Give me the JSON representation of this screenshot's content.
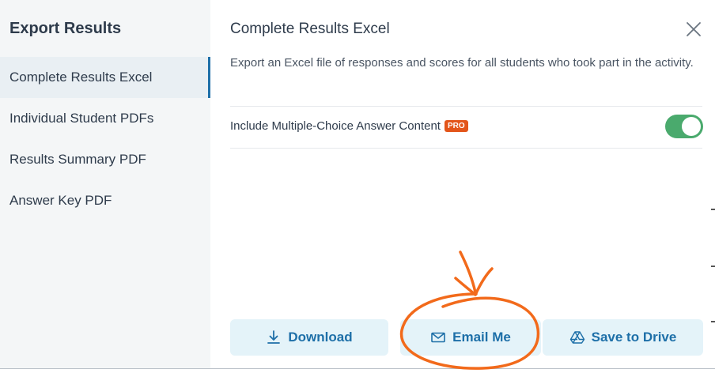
{
  "sidebar": {
    "title": "Export Results",
    "items": [
      {
        "label": "Complete Results Excel",
        "active": true
      },
      {
        "label": "Individual Student PDFs",
        "active": false
      },
      {
        "label": "Results Summary PDF",
        "active": false
      },
      {
        "label": "Answer Key PDF",
        "active": false
      }
    ]
  },
  "main": {
    "title": "Complete Results Excel",
    "description": "Export an Excel file of responses and scores for all students who took part in the activity.",
    "option": {
      "label": "Include Multiple-Choice Answer Content",
      "badge": "PRO",
      "toggle_on": true
    },
    "close_icon": "close-icon"
  },
  "actions": {
    "download_label": "Download",
    "email_label": "Email Me",
    "drive_label": "Save to Drive"
  },
  "icons": {
    "download": "download-icon",
    "email": "envelope-icon",
    "drive": "drive-icon"
  },
  "colors": {
    "accent": "#1d6fa8",
    "button_bg": "#e4f3f9",
    "toggle_on": "#4aaa6d",
    "pro_badge": "#e3551a",
    "annotation": "#f26a1b"
  }
}
